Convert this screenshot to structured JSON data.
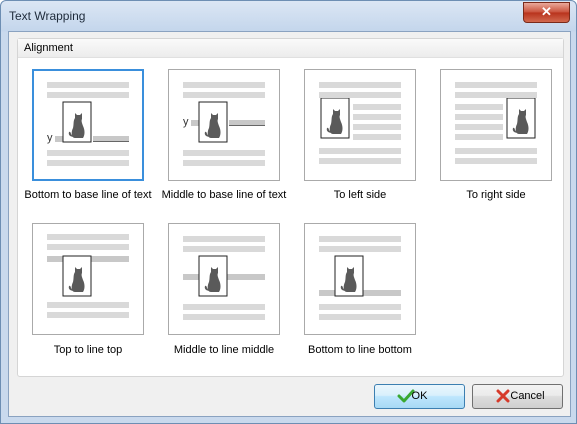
{
  "window": {
    "title": "Text Wrapping",
    "close_label": "✕"
  },
  "group": {
    "title": "Alignment"
  },
  "options": [
    {
      "label": "Bottom to base line of text",
      "mode": "bottom-to-baseline",
      "selected": true
    },
    {
      "label": "Middle to base line of text",
      "mode": "middle-to-baseline",
      "selected": false
    },
    {
      "label": "To left side",
      "mode": "left-side",
      "selected": false
    },
    {
      "label": "To right side",
      "mode": "right-side",
      "selected": false
    },
    {
      "label": "Top to line top",
      "mode": "top-to-line-top",
      "selected": false
    },
    {
      "label": "Middle to line middle",
      "mode": "middle-to-line-middle",
      "selected": false
    },
    {
      "label": "Bottom to line bottom",
      "mode": "bottom-to-line-bottom",
      "selected": false
    }
  ],
  "preview_glyph": "y",
  "buttons": {
    "ok": {
      "label": "OK",
      "icon": "check-icon"
    },
    "cancel": {
      "label": "Cancel",
      "icon": "cross-icon"
    }
  },
  "colors": {
    "selection": "#3a8fdc",
    "text_line": "#d9d9d9",
    "highlight_line": "#c8c8c8",
    "cat": "#5a5a5a",
    "ok_check": "#3aa832",
    "cancel_cross": "#d63a2a"
  }
}
